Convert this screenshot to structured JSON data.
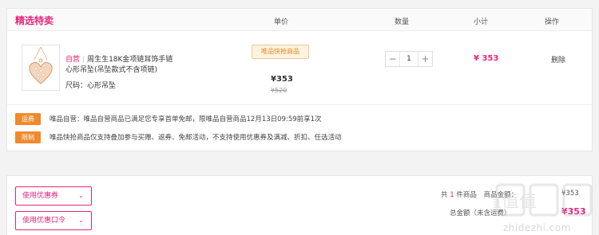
{
  "cart": {
    "section_title": "精选特卖",
    "columns": {
      "price": "单价",
      "quantity": "数量",
      "subtotal": "小计",
      "action": "操作"
    },
    "product": {
      "self_tag": "自营",
      "name_line1": "周生生18K金项链耳饰手链",
      "name_line2": "心形吊坠(吊坠款式不含项链)",
      "size_label": "尺码：心形吊坠",
      "badge": "唯品快抢商品",
      "price_now": "¥353",
      "price_old": "¥520",
      "quantity": "1",
      "subtotal": "¥ 353",
      "delete_label": "删除"
    },
    "notices": [
      {
        "label": "运费",
        "text": "唯品自营：唯品自营商品已满足您专享首单免邮，限唯品自营商品12月13日09:59前享1次"
      },
      {
        "label": "限制",
        "text": "唯品快抢商品仅支持叠加参与买赠、返券、免邮活动，不支持使用优惠券及满减、折扣、任选活动"
      }
    ]
  },
  "bottom": {
    "coupon_button": "使用优惠券",
    "coupon_code_button": "使用优惠口令",
    "summary_prefix": "共",
    "item_count": "1",
    "summary_suffix": "件商品",
    "summary_tail": "商品金额：",
    "goods_amount": "¥353",
    "total_label": "总金额（未含运费）",
    "total_amount": "¥353"
  },
  "watermark": {
    "text": "zhidezhi.com",
    "logo_chars": "值值值"
  },
  "colors": {
    "brand_pink": "#e4287c",
    "notice_orange": "#f08a2c",
    "badge_bg": "#fff3e0"
  },
  "icons": {
    "minus": "minus-icon",
    "plus": "plus-icon",
    "chevron": "chevron-down-icon"
  }
}
